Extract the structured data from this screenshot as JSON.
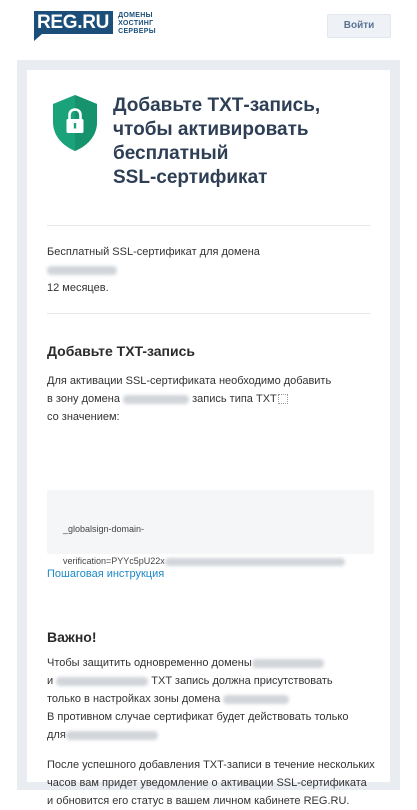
{
  "header": {
    "logo_text": "REG.RU",
    "tagline": [
      "ДОМЕНЫ",
      "ХОСТИНГ",
      "СЕРВЕРЫ"
    ],
    "login_label": "Войти"
  },
  "hero": {
    "title": "Добавьте ТХТ-запись,\nчтобы активировать\nбесплатный\nSSL-сертификат",
    "icon": "lock-shield-icon",
    "icon_color": "#1aa37a"
  },
  "info": {
    "line1": "Бесплатный SSL-сертификат для домена",
    "duration": "12 месяцев."
  },
  "txt_section": {
    "heading": "Добавьте TXT-запись",
    "desc_line1": "Для активации SSL-сертификата необходимо добавить",
    "desc_line2_prefix": "в зону домена",
    "desc_line2_suffix": "запись типа TXT",
    "desc_line3": "со значением:",
    "code_line1": "_globalsign-domain-",
    "code_line2_prefix": "verification=PYYc5pU22x",
    "link_label": "Пошаговая инструкция"
  },
  "important": {
    "heading": "Важно!",
    "line1": "Чтобы защитить одновременно домены",
    "line2_prefix": "и",
    "line2_suffix": "TXT запись должна присутствовать",
    "line3_prefix": "только в настройках зоны домена",
    "line4": "В противном случае сертификат будет действовать только",
    "line5_prefix": "для",
    "para2": "После успешного добавления TXT-записи в течение нескольких часов вам придет уведомление о активации SSL-сертификата и обновится его статус в вашем личном кабинете REG.RU."
  },
  "colors": {
    "brand": "#1b4f79",
    "link": "#1e88c7",
    "background": "#e9edf1"
  }
}
